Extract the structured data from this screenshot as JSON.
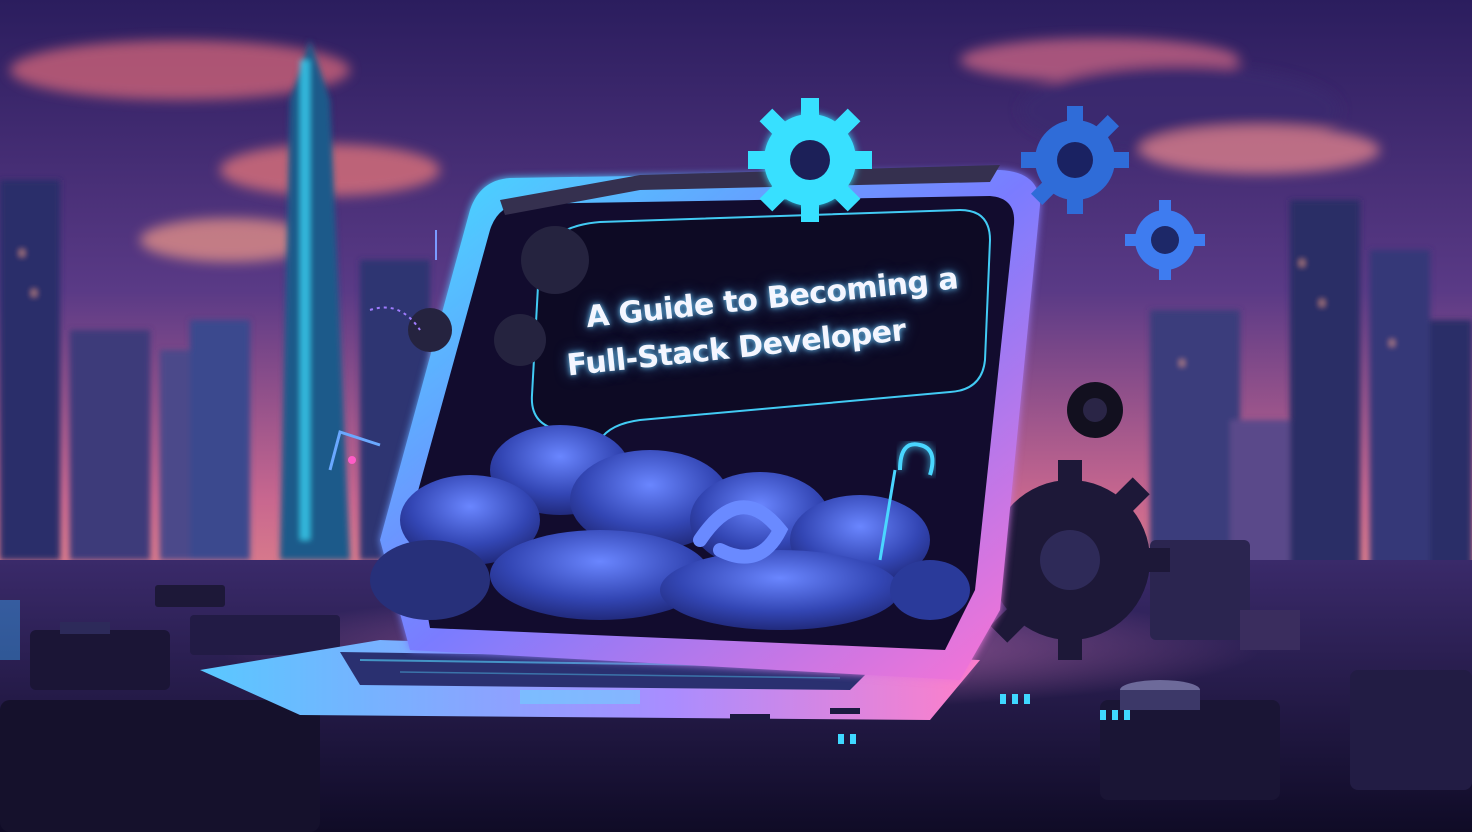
{
  "title": {
    "line1": "A Guide to Becoming a",
    "line2": "Full-Stack Developer"
  },
  "colors": {
    "sky_top": "#2a1c5c",
    "sky_horizon": "#e0708e",
    "neon_cyan": "#39d6ff",
    "neon_pink": "#ff6ad0",
    "screen_dark": "#120c2e",
    "cloud_blue": "#3d54c8"
  },
  "icons": [
    "gear-icon",
    "cloud-icon",
    "laptop-icon",
    "city-skyline"
  ]
}
